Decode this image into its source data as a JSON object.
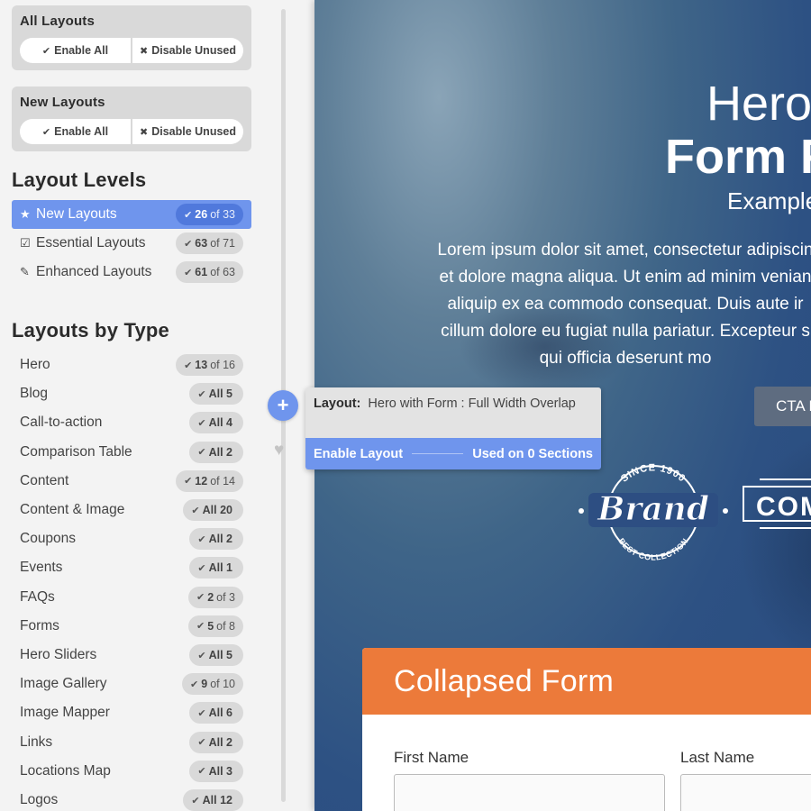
{
  "all_layouts": {
    "title": "All Layouts",
    "enable_label": "Enable All",
    "disable_label": "Disable Unused"
  },
  "new_layouts": {
    "title": "New Layouts",
    "enable_label": "Enable All",
    "disable_label": "Disable Unused"
  },
  "layout_levels": {
    "heading": "Layout Levels",
    "items": [
      {
        "icon": "star-icon",
        "label": "New Layouts",
        "count": "26",
        "of": "of 33",
        "active": true
      },
      {
        "icon": "checkbox-icon",
        "label": "Essential Layouts",
        "count": "63",
        "of": "of 71"
      },
      {
        "icon": "wand-icon",
        "label": "Enhanced Layouts",
        "count": "61",
        "of": "of 63"
      }
    ]
  },
  "layouts_by_type": {
    "heading": "Layouts by Type",
    "items": [
      {
        "label": "Hero",
        "count": "13",
        "of": "of 16"
      },
      {
        "label": "Blog",
        "count": "All 5",
        "of": ""
      },
      {
        "label": "Call-to-action",
        "count": "All 4",
        "of": ""
      },
      {
        "label": "Comparison Table",
        "count": "All 2",
        "of": ""
      },
      {
        "label": "Content",
        "count": "12",
        "of": "of 14"
      },
      {
        "label": "Content & Image",
        "count": "All 20",
        "of": ""
      },
      {
        "label": "Coupons",
        "count": "All 2",
        "of": ""
      },
      {
        "label": "Events",
        "count": "All 1",
        "of": ""
      },
      {
        "label": "FAQs",
        "count": "2",
        "of": "of 3"
      },
      {
        "label": "Forms",
        "count": "5",
        "of": "of 8"
      },
      {
        "label": "Hero Sliders",
        "count": "All 5",
        "of": ""
      },
      {
        "label": "Image Gallery",
        "count": "9",
        "of": "of 10"
      },
      {
        "label": "Image Mapper",
        "count": "All 6",
        "of": ""
      },
      {
        "label": "Links",
        "count": "All 2",
        "of": ""
      },
      {
        "label": "Locations Map",
        "count": "All 3",
        "of": ""
      },
      {
        "label": "Logos",
        "count": "All 12",
        "of": ""
      }
    ]
  },
  "popover": {
    "layout_label": "Layout:",
    "layout_name": "Hero with Form : Full Width Overlap",
    "enable_label": "Enable Layout",
    "used_label": "Used on 0 Sections"
  },
  "preview": {
    "title_line1": "Hero",
    "title_line2": "Form F",
    "subtitle": "Example",
    "paragraph": [
      "Lorem ipsum dolor sit amet, consectetur adipiscin",
      "et dolore magna aliqua. Ut enim ad minim venian",
      "aliquip ex ea commodo consequat. Duis aute ir",
      "cillum dolore eu fugiat nulla pariatur. Excepteur s",
      "qui officia deserunt mo"
    ],
    "cta_label": "CTA B",
    "brand_logo": {
      "since": "SINCE 1900",
      "name": "Brand",
      "tagline": "BEST COLLECTION"
    },
    "comp_logo": {
      "name": "COM"
    },
    "form_title": "Collapsed Form",
    "first_name_label": "First Name",
    "last_name_label": "Last Name"
  },
  "colors": {
    "accent": "#6f95ed",
    "form_header": "#ec7a3a",
    "sidebar_bg": "#f3f3f3",
    "card_bg": "#d9d9d9"
  }
}
